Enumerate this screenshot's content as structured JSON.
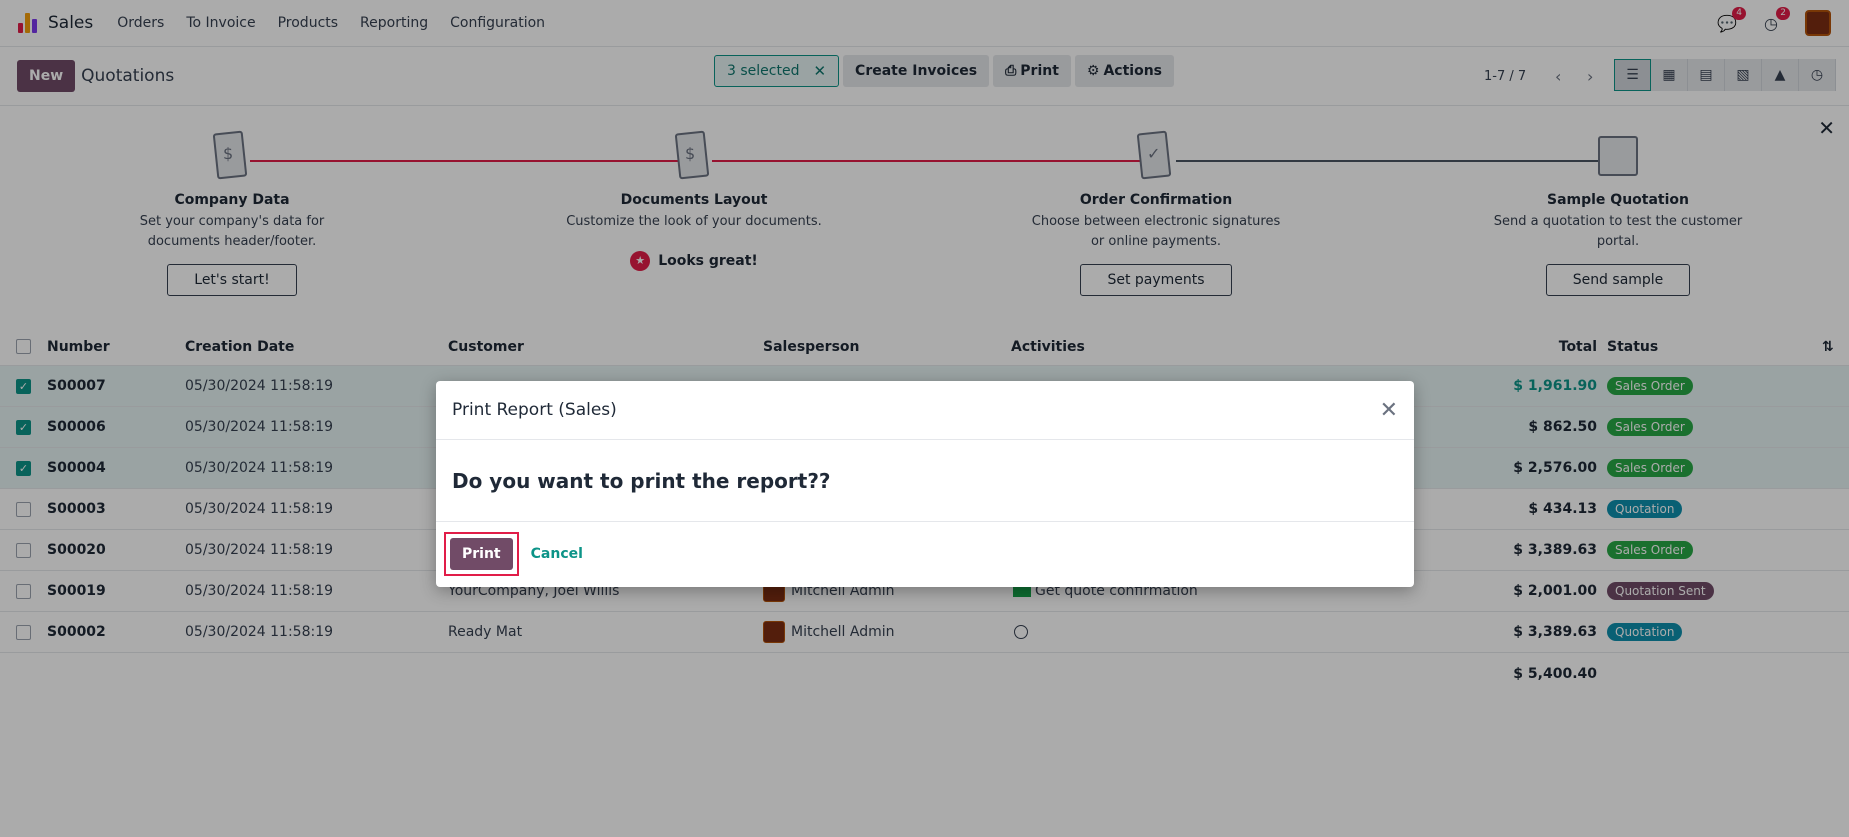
{
  "nav": {
    "app_name": "Sales",
    "items": [
      "Orders",
      "To Invoice",
      "Products",
      "Reporting",
      "Configuration"
    ],
    "messages_badge": "4",
    "activities_badge": "2"
  },
  "control": {
    "new_label": "New",
    "title": "Quotations",
    "selected_label": "3 selected",
    "create_invoices": "Create Invoices",
    "print": "Print",
    "actions": "Actions",
    "pager": "1-7 / 7"
  },
  "onboarding": {
    "steps": [
      {
        "title": "Company Data",
        "desc": "Set your company's data for documents header/footer.",
        "button": "Let's start!"
      },
      {
        "title": "Documents Layout",
        "desc": "Customize the look of your documents.",
        "done": "Looks great!"
      },
      {
        "title": "Order Confirmation",
        "desc": "Choose between electronic signatures or online payments.",
        "button": "Set payments"
      },
      {
        "title": "Sample Quotation",
        "desc": "Send a quotation to test the customer portal.",
        "button": "Send sample"
      }
    ]
  },
  "table": {
    "headers": {
      "number": "Number",
      "creation_date": "Creation Date",
      "customer": "Customer",
      "salesperson": "Salesperson",
      "activities": "Activities",
      "total": "Total",
      "status": "Status"
    },
    "rows": [
      {
        "number": "S00007",
        "date": "05/30/2024 11:58:19",
        "customer": "",
        "salesperson": "",
        "activity": "",
        "total": "$ 1,961.90",
        "status": "Sales Order"
      },
      {
        "number": "S00006",
        "date": "05/30/2024 11:58:19",
        "customer": "",
        "salesperson": "",
        "activity": "",
        "total": "$ 862.50",
        "status": "Sales Order"
      },
      {
        "number": "S00004",
        "date": "05/30/2024 11:58:19",
        "customer": "",
        "salesperson": "",
        "activity": "",
        "total": "$ 2,576.00",
        "status": "Sales Order"
      },
      {
        "number": "S00003",
        "date": "05/30/2024 11:58:19",
        "customer": "",
        "salesperson": "",
        "activity": "",
        "total": "$ 434.13",
        "status": "Quotation"
      },
      {
        "number": "S00020",
        "date": "05/30/2024 11:58:19",
        "customer": "",
        "salesperson": "",
        "activity": "",
        "total": "$ 3,389.63",
        "status": "Sales Order"
      },
      {
        "number": "S00019",
        "date": "05/30/2024 11:58:19",
        "customer": "YourCompany, Joel Willis",
        "salesperson": "Mitchell Admin",
        "activity": "Get quote confirmation",
        "total": "$ 2,001.00",
        "status": "Quotation Sent"
      },
      {
        "number": "S00002",
        "date": "05/30/2024 11:58:19",
        "customer": "Ready Mat",
        "salesperson": "Mitchell Admin",
        "activity": "",
        "total": "$ 3,389.63",
        "status": "Quotation"
      }
    ],
    "sum_total": "$ 5,400.40"
  },
  "dialog": {
    "title": "Print Report (Sales)",
    "question": "Do you want to print the report??",
    "print_label": "Print",
    "cancel_label": "Cancel"
  }
}
